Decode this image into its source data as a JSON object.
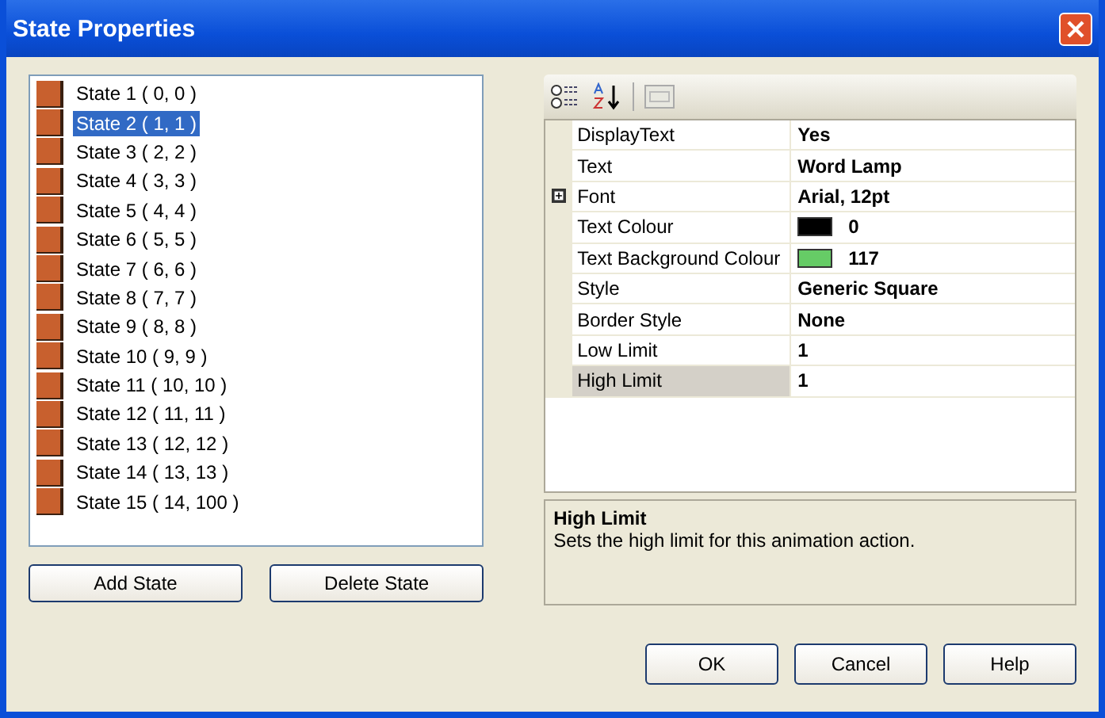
{
  "window": {
    "title": "State Properties"
  },
  "states": [
    {
      "label": "State 1 ( 0, 0 )",
      "selected": false
    },
    {
      "label": "State 2 ( 1, 1 )",
      "selected": true
    },
    {
      "label": "State 3 ( 2, 2 )",
      "selected": false
    },
    {
      "label": "State 4 ( 3, 3 )",
      "selected": false
    },
    {
      "label": "State 5 ( 4, 4 )",
      "selected": false
    },
    {
      "label": "State 6 ( 5, 5 )",
      "selected": false
    },
    {
      "label": "State 7 ( 6, 6 )",
      "selected": false
    },
    {
      "label": "State 8 ( 7, 7 )",
      "selected": false
    },
    {
      "label": "State 9 ( 8, 8 )",
      "selected": false
    },
    {
      "label": "State 10 ( 9, 9 )",
      "selected": false
    },
    {
      "label": "State 11 ( 10, 10 )",
      "selected": false
    },
    {
      "label": "State 12 ( 11, 11 )",
      "selected": false
    },
    {
      "label": "State 13 ( 12, 12 )",
      "selected": false
    },
    {
      "label": "State 14 ( 13, 13 )",
      "selected": false
    },
    {
      "label": "State 15 ( 14, 100 )",
      "selected": false
    }
  ],
  "state_buttons": [
    "Add State",
    "Delete State"
  ],
  "properties": [
    {
      "name": "DisplayText",
      "value": "Yes",
      "kind": "text",
      "selected": false
    },
    {
      "name": "Text",
      "value": "Word Lamp",
      "kind": "text",
      "selected": false
    },
    {
      "name": "Font",
      "value": "Arial, 12pt",
      "kind": "expandable",
      "expanded": false,
      "selected": false
    },
    {
      "name": "Text Colour",
      "value": "0",
      "kind": "color",
      "color": "#000000",
      "selected": false
    },
    {
      "name": "Text Background Colour",
      "value": "117",
      "kind": "color",
      "color": "#66cc66",
      "selected": false
    },
    {
      "name": "Style",
      "value": "Generic Square",
      "kind": "text",
      "selected": false
    },
    {
      "name": "Border Style",
      "value": "None",
      "kind": "text",
      "selected": false
    },
    {
      "name": "Low Limit",
      "value": "1",
      "kind": "text",
      "selected": false
    },
    {
      "name": "High Limit",
      "value": "1",
      "kind": "text",
      "selected": true
    }
  ],
  "description": {
    "title": "High Limit",
    "text": "Sets the high limit for this animation action."
  },
  "buttons": [
    "OK",
    "Cancel",
    "Help"
  ]
}
